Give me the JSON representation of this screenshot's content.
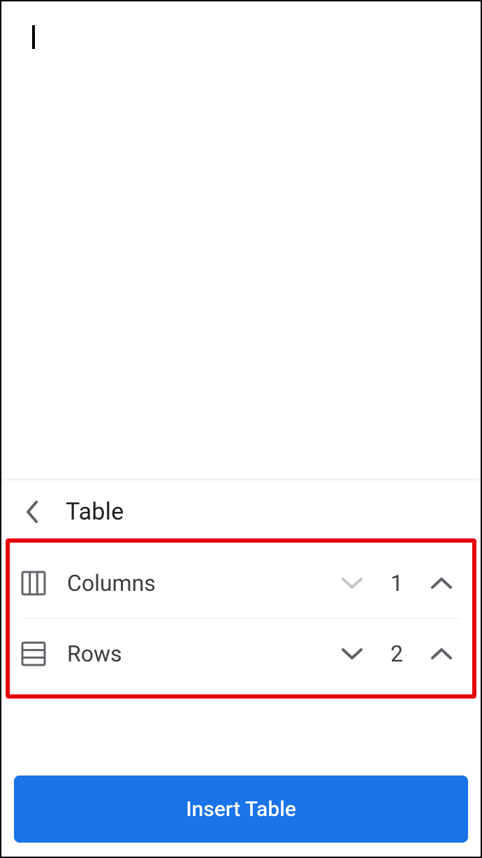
{
  "panel": {
    "title": "Table",
    "columns": {
      "label": "Columns",
      "value": "1"
    },
    "rows": {
      "label": "Rows",
      "value": "2"
    },
    "insert_label": "Insert Table"
  }
}
